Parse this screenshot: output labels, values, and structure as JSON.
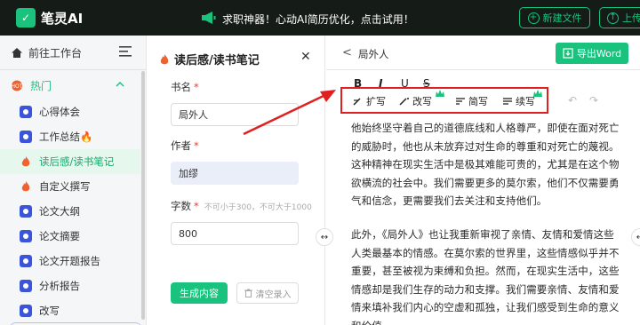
{
  "topbar": {
    "logo_mark": "✓",
    "brand": "笔灵AI",
    "promo_icon": "megaphone-icon",
    "promo": "求职神器！心动AI简历优化，点击试用！",
    "new_file": "新建文件",
    "upload": "上传"
  },
  "sidebar": {
    "workspace": "前往工作台",
    "hot": "热门",
    "items": [
      {
        "label": "心得体会",
        "icon": "doc-icon"
      },
      {
        "label": "工作总结🔥",
        "icon": "doc-icon"
      },
      {
        "label": "读后感/读书笔记",
        "icon": "flame-icon",
        "active": true
      },
      {
        "label": "自定义撰写",
        "icon": "flame-icon"
      },
      {
        "label": "论文大纲",
        "icon": "doc-icon"
      },
      {
        "label": "论文摘要",
        "icon": "doc-icon"
      },
      {
        "label": "论文开题报告",
        "icon": "doc-icon"
      },
      {
        "label": "分析报告",
        "icon": "doc-icon"
      },
      {
        "label": "改写",
        "icon": "doc-icon"
      }
    ]
  },
  "form": {
    "title": "读后感/读书笔记",
    "book_label": "书名",
    "book_value": "局外人",
    "author_label": "作者",
    "author_value": "加缪",
    "count_label": "字数",
    "count_hint": "不可小于300，不可大于1000",
    "count_value": "800",
    "generate": "生成内容",
    "clear": "清空录入"
  },
  "editor": {
    "title": "局外人",
    "export": "导出Word",
    "format": {
      "bold": "B",
      "italic": "I",
      "underline": "U",
      "strike": "S"
    },
    "ai_tools": [
      "扩写",
      "改写",
      "简写",
      "续写"
    ],
    "paragraphs": [
      "他始终坚守着自己的道德底线和人格尊严，即使在面对死亡的威胁时，他也从未放弃过对生命的尊重和对死亡的蔑视。这种精神在现实生活中是极其难能可贵的，尤其是在这个物欲横流的社会中。我们需要更多的莫尔索，他们不仅需要勇气和信念，更需要我们去关注和支持他们。",
      "此外，《局外人》也让我重新审视了亲情、友情和爱情这些人类最基本的情感。在莫尔索的世界里，这些情感似乎并不重要，甚至被视为束缚和负担。然而，在现实生活中，这些情感却是我们生存的动力和支撑。我们需要亲情、友情和爱情来填补我们内心的空虚和孤独，让我们感受到生命的意义和价值。"
    ]
  },
  "colors": {
    "accent": "#19c37d",
    "highlight": "#e02020",
    "topbar": "#151b17"
  }
}
